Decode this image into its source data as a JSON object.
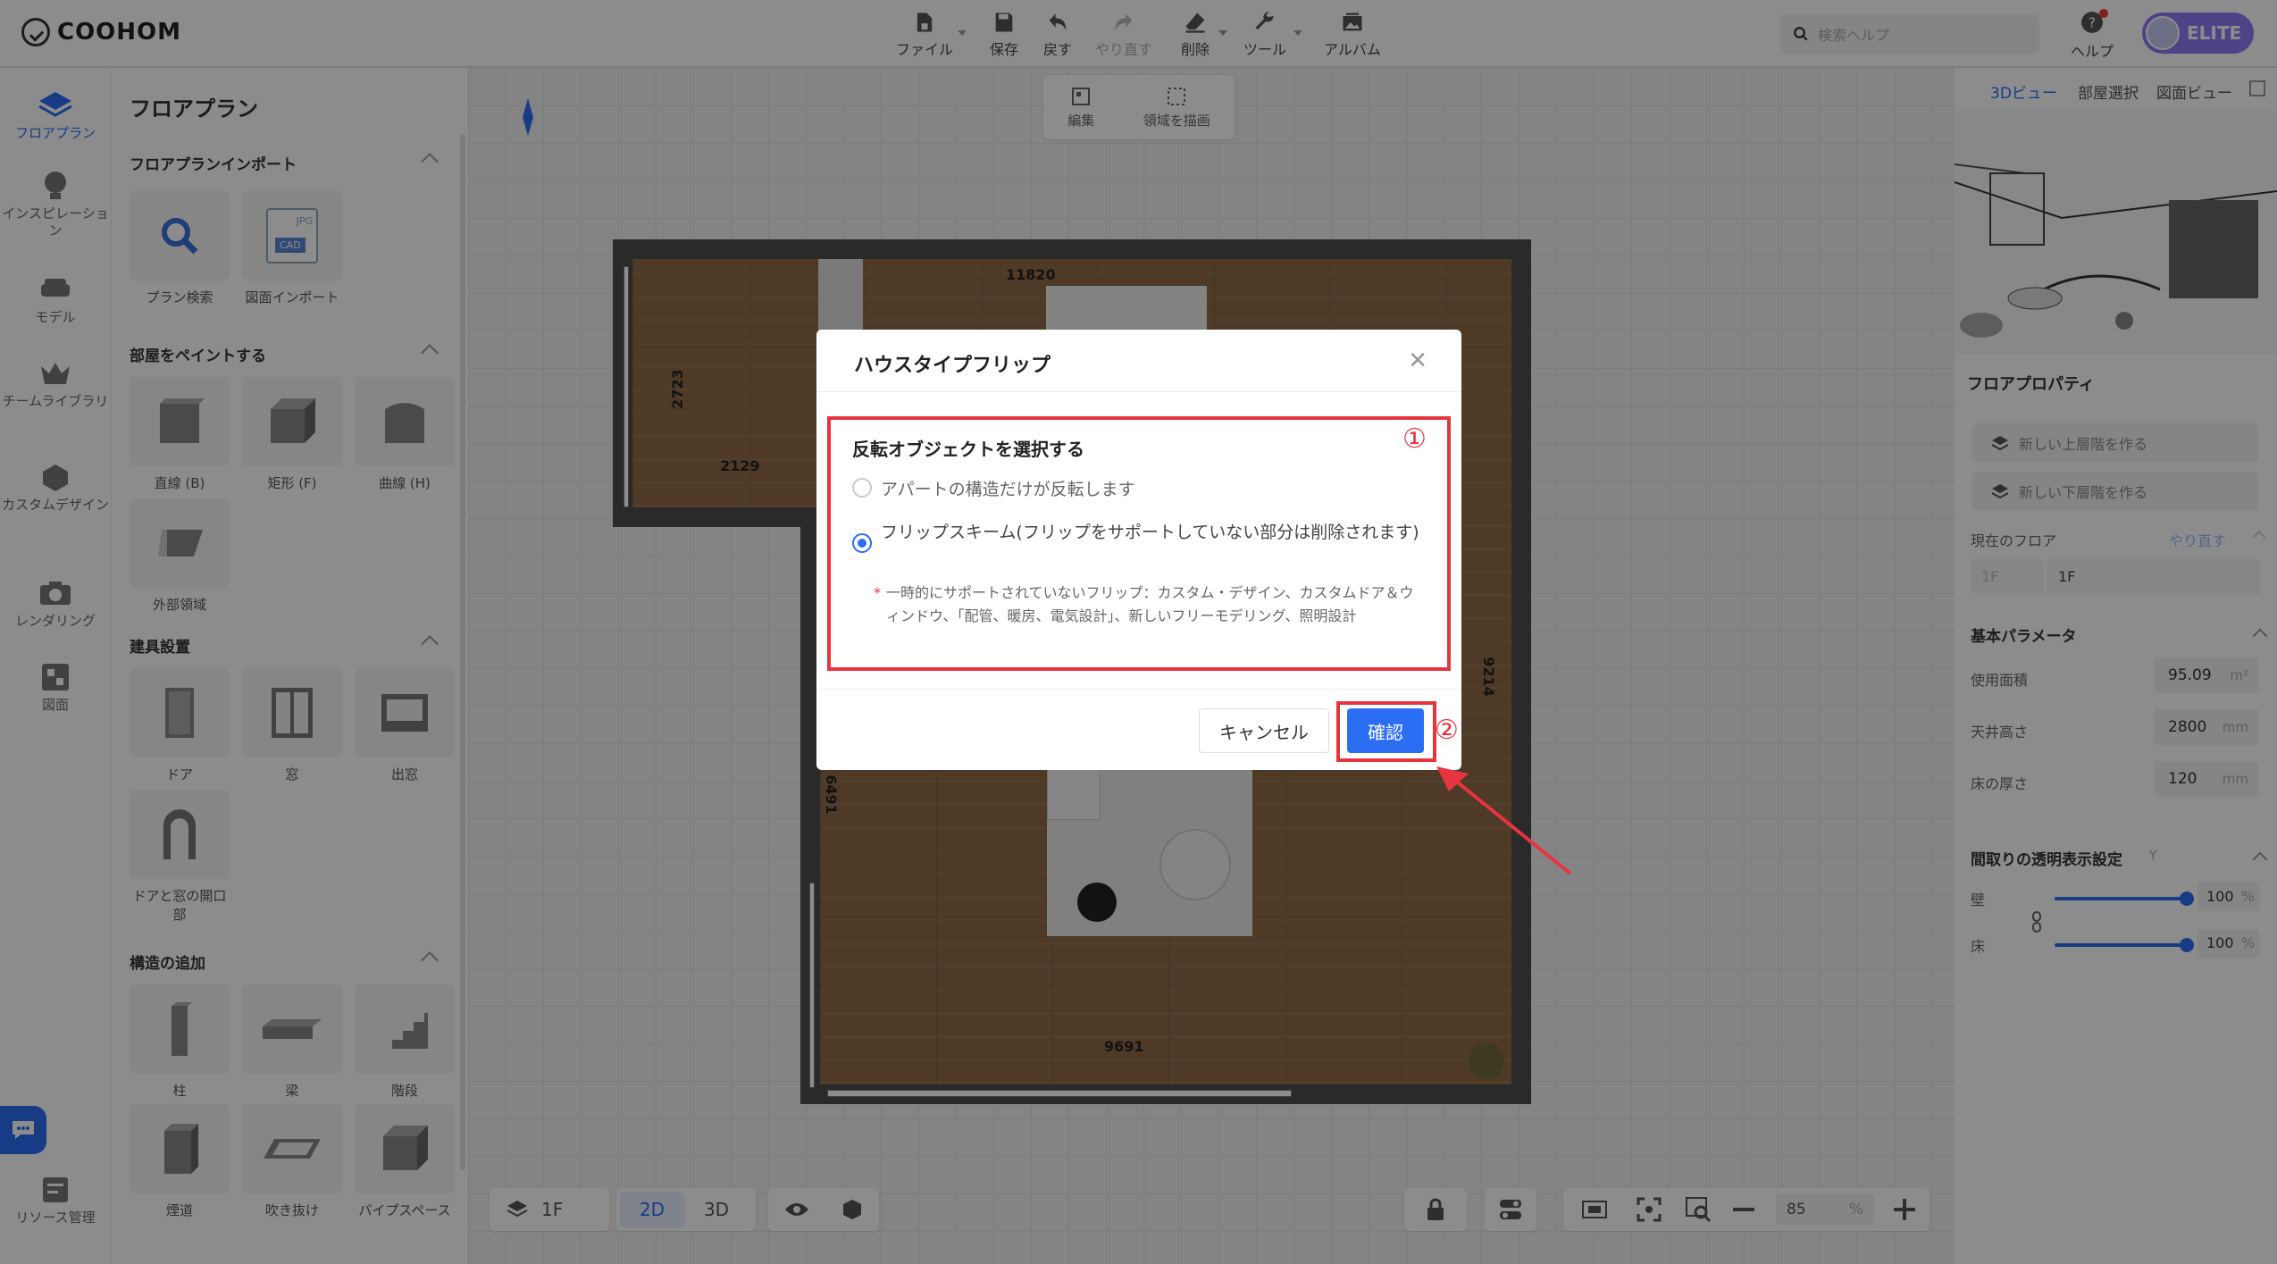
{
  "app": {
    "logo": "COOHOM"
  },
  "toolbar": {
    "file": "ファイル",
    "save": "保存",
    "undo": "戻す",
    "redo": "やり直す",
    "delete": "削除",
    "tools": "ツール",
    "album": "アルバム"
  },
  "search": {
    "placeholder": "検索ヘルプ"
  },
  "help": "ヘルプ",
  "badge": "ELITE",
  "leftnav": {
    "floorplan": "フロアプラン",
    "inspiration": "インスピレーション",
    "model": "モデル",
    "team_library": "チームライブラリ",
    "custom_design": "カスタムデザイン",
    "rendering": "レンダリング",
    "drawing": "図面",
    "resource_mgmt": "リソース管理"
  },
  "panel": {
    "title": "フロアプラン",
    "import_section": "フロアプランインポート",
    "import_items": [
      "プラン検索",
      "図面インポート"
    ],
    "jpg": "JPG",
    "cad": "CAD",
    "paint_section": "部屋をペイントする",
    "paint_items": [
      "直線 (B)",
      "矩形 (F)",
      "曲線 (H)",
      "外部領域"
    ],
    "fixture_section": "建具設置",
    "fixture_items": [
      "ドア",
      "窓",
      "出窓",
      "ドアと窓の開口部"
    ],
    "structure_section": "構造の追加",
    "structure_items": [
      "柱",
      "梁",
      "階段",
      "煙道",
      "吹き抜け",
      "パイプスペース"
    ]
  },
  "edit_toolbar": {
    "edit": "編集",
    "draw_area": "領域を描画"
  },
  "dimensions": {
    "top": "11820",
    "left": "2723",
    "inner": "2129",
    "right": "9214",
    "inner_left": "6491",
    "bottom": "9691"
  },
  "right": {
    "tabs": [
      "3Dビュー",
      "部屋選択",
      "図面ビュー"
    ],
    "props_title": "フロアプロパティ",
    "new_upper": "新しい上層階を作る",
    "new_lower": "新しい下層階を作る",
    "current_floor": "現在のフロア",
    "redo": "やり直す",
    "floor_a": "1F",
    "floor_b": "1F",
    "basic_params": "基本パラメータ",
    "area_label": "使用面積",
    "area": "95.09",
    "area_unit": "m²",
    "ceiling_label": "天井高さ",
    "ceiling": "2800",
    "ceiling_unit": "mm",
    "floor_thick_label": "床の厚さ",
    "floor_thick": "120",
    "floor_thick_unit": "mm",
    "transparency": "間取りの透明表示設定",
    "transparency_key": "Y",
    "wall": "壁",
    "wall_val": "100",
    "floor": "床",
    "floor_val": "100",
    "pct": "%"
  },
  "bottom": {
    "floor": "1F",
    "mode2d": "2D",
    "mode3d": "3D",
    "zoom": "85",
    "pct": "%"
  },
  "dialog": {
    "title": "ハウスタイプフリップ",
    "section": "反転オブジェクトを選択する",
    "option1": "アパートの構造だけが反転します",
    "option2": "フリップスキーム(フリップをサポートしていない部分は削除されます)",
    "note_star": "*",
    "note": "一時的にサポートされていないフリップ：カスタム・デザイン、カスタムドア＆ウィンドウ、「配管、暖房、電気設計」、新しいフリーモデリング、照明設計",
    "cancel": "キャンセル",
    "confirm": "確認",
    "marker1": "①",
    "marker2": "②"
  },
  "colors": {
    "accent": "#2b6ef3",
    "annotation": "#e8343f",
    "floor": "#8e6b48"
  }
}
